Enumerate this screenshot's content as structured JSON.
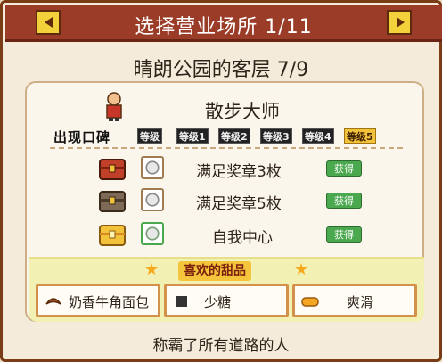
{
  "header": {
    "title": "选择营业场所 1/11"
  },
  "location": {
    "name": "晴朗公园的客层 7/9"
  },
  "customer": {
    "rank_name": "散步大师",
    "appear_label": "出现口碑",
    "levels": [
      "等级",
      "等级1",
      "等级2",
      "等级3",
      "等级4",
      "等级5"
    ],
    "active_level": "等级5"
  },
  "requirements": [
    {
      "text": "满足奖章3枚",
      "status": "获得",
      "chest": "red"
    },
    {
      "text": "满足奖章5枚",
      "status": "获得",
      "chest": "dark"
    },
    {
      "text": "自我中心",
      "status": "获得",
      "chest": "gold"
    }
  ],
  "favorites": {
    "label": "喜欢的甜品",
    "items": [
      "奶香牛角面包",
      "少糖",
      "爽滑"
    ]
  },
  "caption": "称霸了所有道路的人",
  "colors": {
    "title_bar": "#9b3c28",
    "ok": "#4aa84e",
    "likes_bg": "#f3f0b3"
  }
}
